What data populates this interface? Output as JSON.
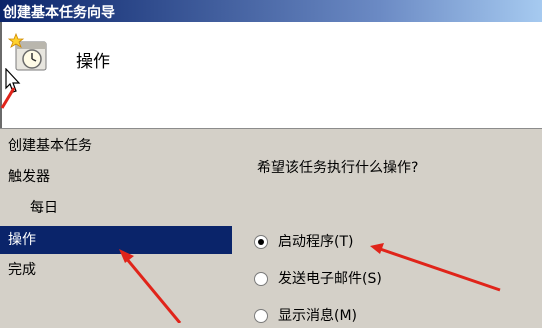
{
  "window": {
    "title": "创建基本任务向导"
  },
  "header": {
    "title": "操作"
  },
  "nav": {
    "items": [
      {
        "label": "创建基本任务",
        "active": false,
        "sub": false
      },
      {
        "label": "触发器",
        "active": false,
        "sub": false
      },
      {
        "label": "每日",
        "active": false,
        "sub": true
      },
      {
        "label": "操作",
        "active": true,
        "sub": false
      },
      {
        "label": "完成",
        "active": false,
        "sub": false
      }
    ]
  },
  "content": {
    "question": "希望该任务执行什么操作?",
    "options": [
      {
        "label": "启动程序(T)",
        "checked": true
      },
      {
        "label": "发送电子邮件(S)",
        "checked": false
      },
      {
        "label": "显示消息(M)",
        "checked": false
      }
    ]
  },
  "colors": {
    "arrow": "#e0241a",
    "selection": "#0a246a",
    "titlebar": "#0a246a"
  }
}
